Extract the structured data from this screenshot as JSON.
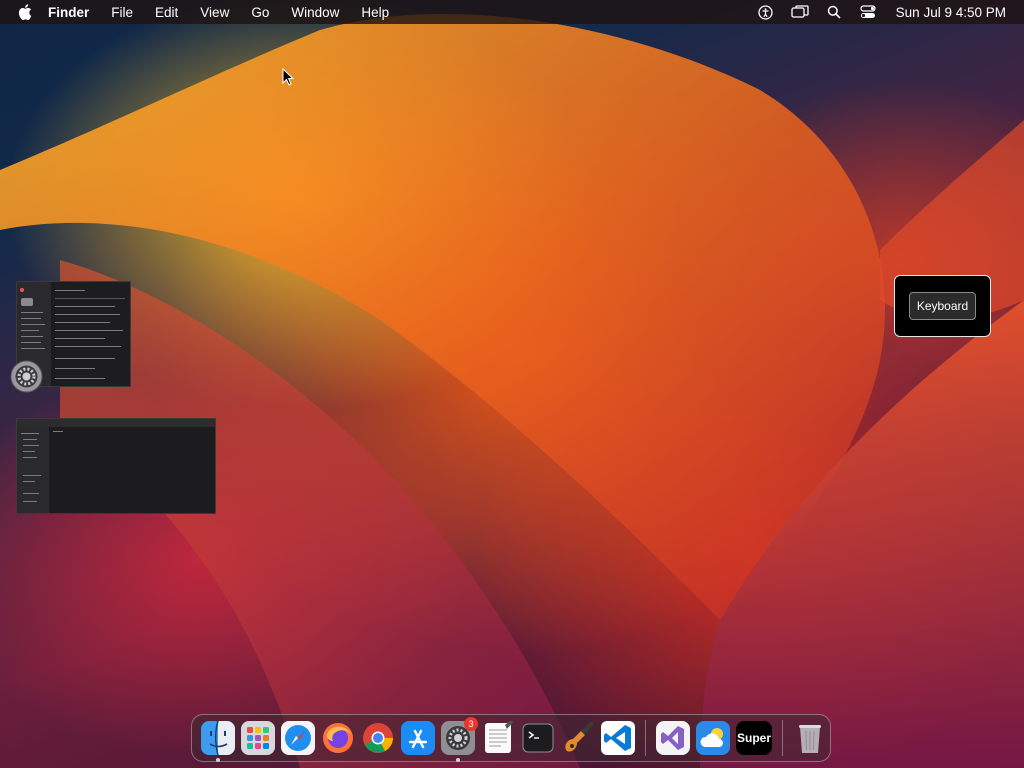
{
  "menubar": {
    "app_name": "Finder",
    "items": [
      "File",
      "Edit",
      "View",
      "Go",
      "Window",
      "Help"
    ],
    "status_icons": [
      "accessibility-icon",
      "screen-mirroring-icon",
      "spotlight-search-icon",
      "control-center-icon"
    ],
    "clock": "Sun Jul 9  4:50 PM"
  },
  "overlay": {
    "label": "Keyboard"
  },
  "dock": {
    "apps": [
      {
        "name": "Finder",
        "icon": "finder-icon",
        "running": true
      },
      {
        "name": "Launchpad",
        "icon": "launchpad-icon",
        "running": false
      },
      {
        "name": "Safari",
        "icon": "safari-icon",
        "running": false
      },
      {
        "name": "Firefox",
        "icon": "firefox-icon",
        "running": false
      },
      {
        "name": "Google Chrome",
        "icon": "chrome-icon",
        "running": false
      },
      {
        "name": "App Store",
        "icon": "app-store-icon",
        "running": false
      },
      {
        "name": "System Settings",
        "icon": "system-settings-icon",
        "running": true,
        "badge": "3"
      },
      {
        "name": "TextEdit",
        "icon": "textedit-icon",
        "running": false
      },
      {
        "name": "Terminal",
        "icon": "terminal-icon",
        "running": false
      },
      {
        "name": "GarageBand",
        "icon": "garageband-icon",
        "running": false
      },
      {
        "name": "Visual Studio Code",
        "icon": "vscode-icon",
        "running": false
      },
      {
        "name": "Visual Studio",
        "icon": "visual-studio-icon",
        "running": false
      },
      {
        "name": "Weather",
        "icon": "weather-icon",
        "running": false
      },
      {
        "name": "Super",
        "icon": "super-icon",
        "label": "Super",
        "running": false
      },
      {
        "name": "Trash",
        "icon": "trash-icon",
        "running": false
      }
    ]
  }
}
